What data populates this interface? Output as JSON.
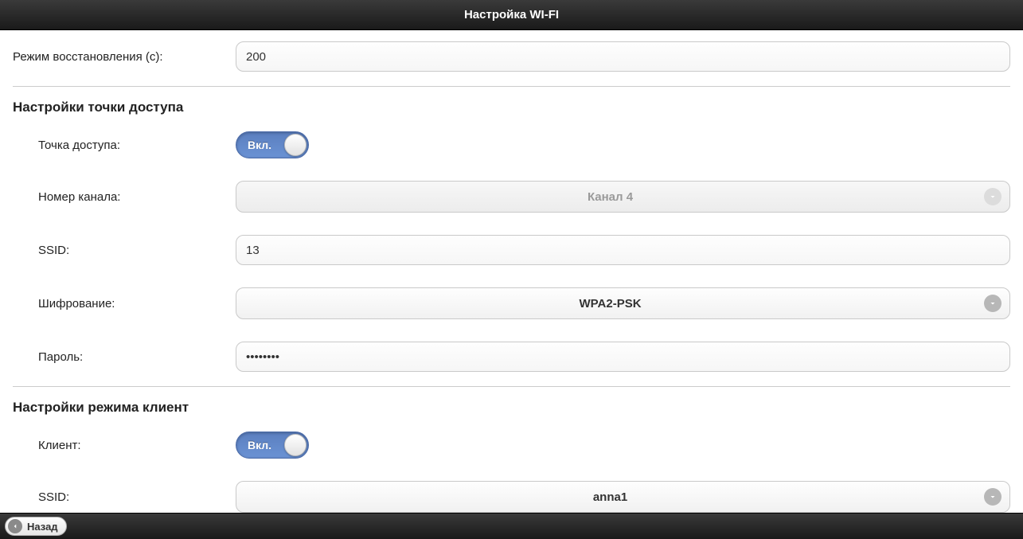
{
  "header": {
    "title": "Настройка WI-FI"
  },
  "recovery": {
    "label": "Режим восстановления (с):",
    "value": "200"
  },
  "ap": {
    "heading": "Настройки точки доступа",
    "enable_label": "Точка доступа:",
    "toggle_text": "Вкл.",
    "toggle_on": true,
    "channel_label": "Номер канала:",
    "channel_value": "Канал 4",
    "channel_disabled": true,
    "ssid_label": "SSID:",
    "ssid_value": "13",
    "encryption_label": "Шифрование:",
    "encryption_value": "WPA2-PSK",
    "password_label": "Пароль:",
    "password_value": "••••••••"
  },
  "client": {
    "heading": "Настройки режима клиент",
    "enable_label": "Клиент:",
    "toggle_text": "Вкл.",
    "toggle_on": true,
    "ssid_label": "SSID:",
    "ssid_value": "anna1"
  },
  "footer": {
    "back_label": "Назад"
  }
}
